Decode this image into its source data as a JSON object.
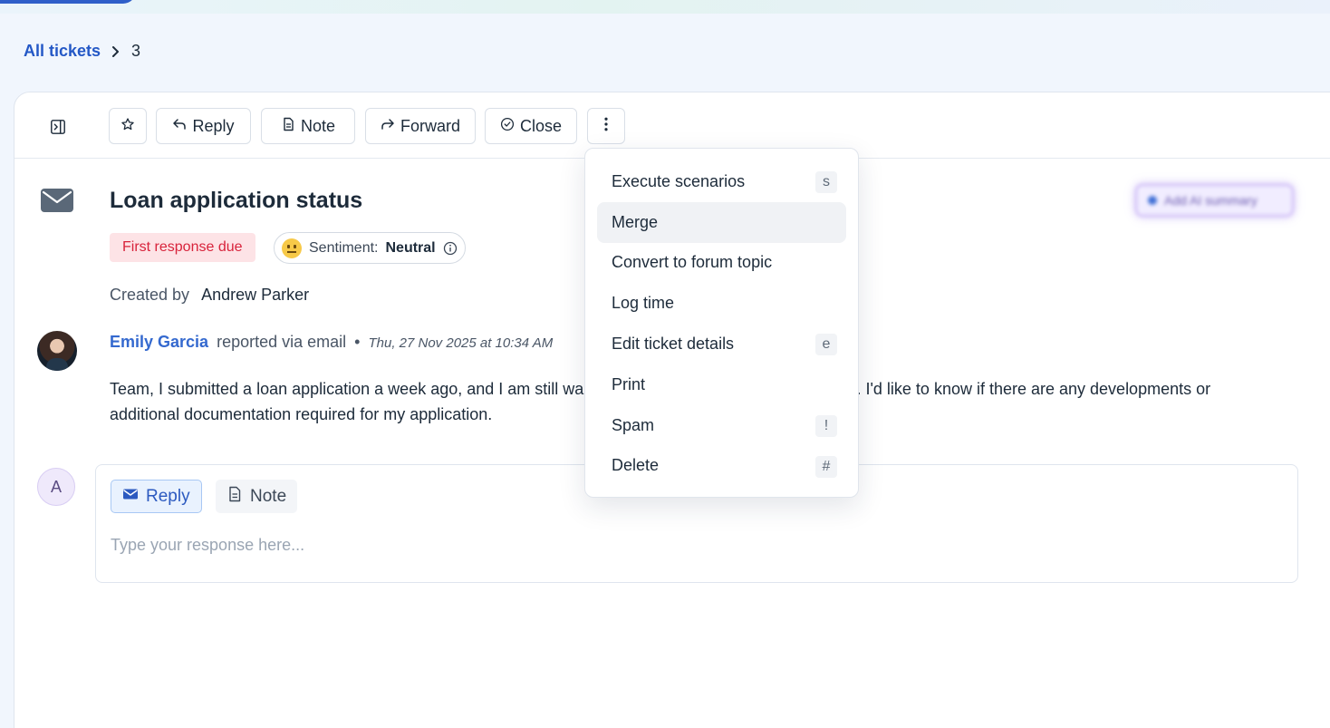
{
  "breadcrumb": {
    "root": "All tickets",
    "current": "3"
  },
  "toolbar": {
    "reply_label": "Reply",
    "note_label": "Note",
    "forward_label": "Forward",
    "close_label": "Close"
  },
  "ticket": {
    "title": "Loan application status",
    "badge": "First response due",
    "sentiment_label": "Sentiment:",
    "sentiment_value": "Neutral",
    "created_label": "Created by",
    "created_by": "Andrew Parker",
    "ai_summary": "Add AI summary"
  },
  "message": {
    "author": "Emily Garcia",
    "via": "reported via email",
    "separator": "•",
    "timestamp": "Thu, 27 Nov 2025 at 10:34 AM",
    "body": "Team, I submitted a loan application a week ago, and I am still waiting for an update regarding its status. I'd like to know if there are any developments or additional documentation required for my application."
  },
  "reply": {
    "avatar_initial": "A",
    "tab_reply": "Reply",
    "tab_note": "Note",
    "placeholder": "Type your response here..."
  },
  "menu": {
    "items": [
      {
        "label": "Execute scenarios",
        "shortcut": "s"
      },
      {
        "label": "Merge",
        "shortcut": ""
      },
      {
        "label": "Convert to forum topic",
        "shortcut": ""
      },
      {
        "label": "Log time",
        "shortcut": ""
      },
      {
        "label": "Edit ticket details",
        "shortcut": "e"
      },
      {
        "label": "Print",
        "shortcut": ""
      },
      {
        "label": "Spam",
        "shortcut": "!"
      },
      {
        "label": "Delete",
        "shortcut": "#"
      }
    ]
  },
  "colors": {
    "accent": "#2458c6",
    "due_badge_bg": "#fde3e6",
    "due_badge_text": "#d8233b",
    "author": "#3469cf"
  }
}
